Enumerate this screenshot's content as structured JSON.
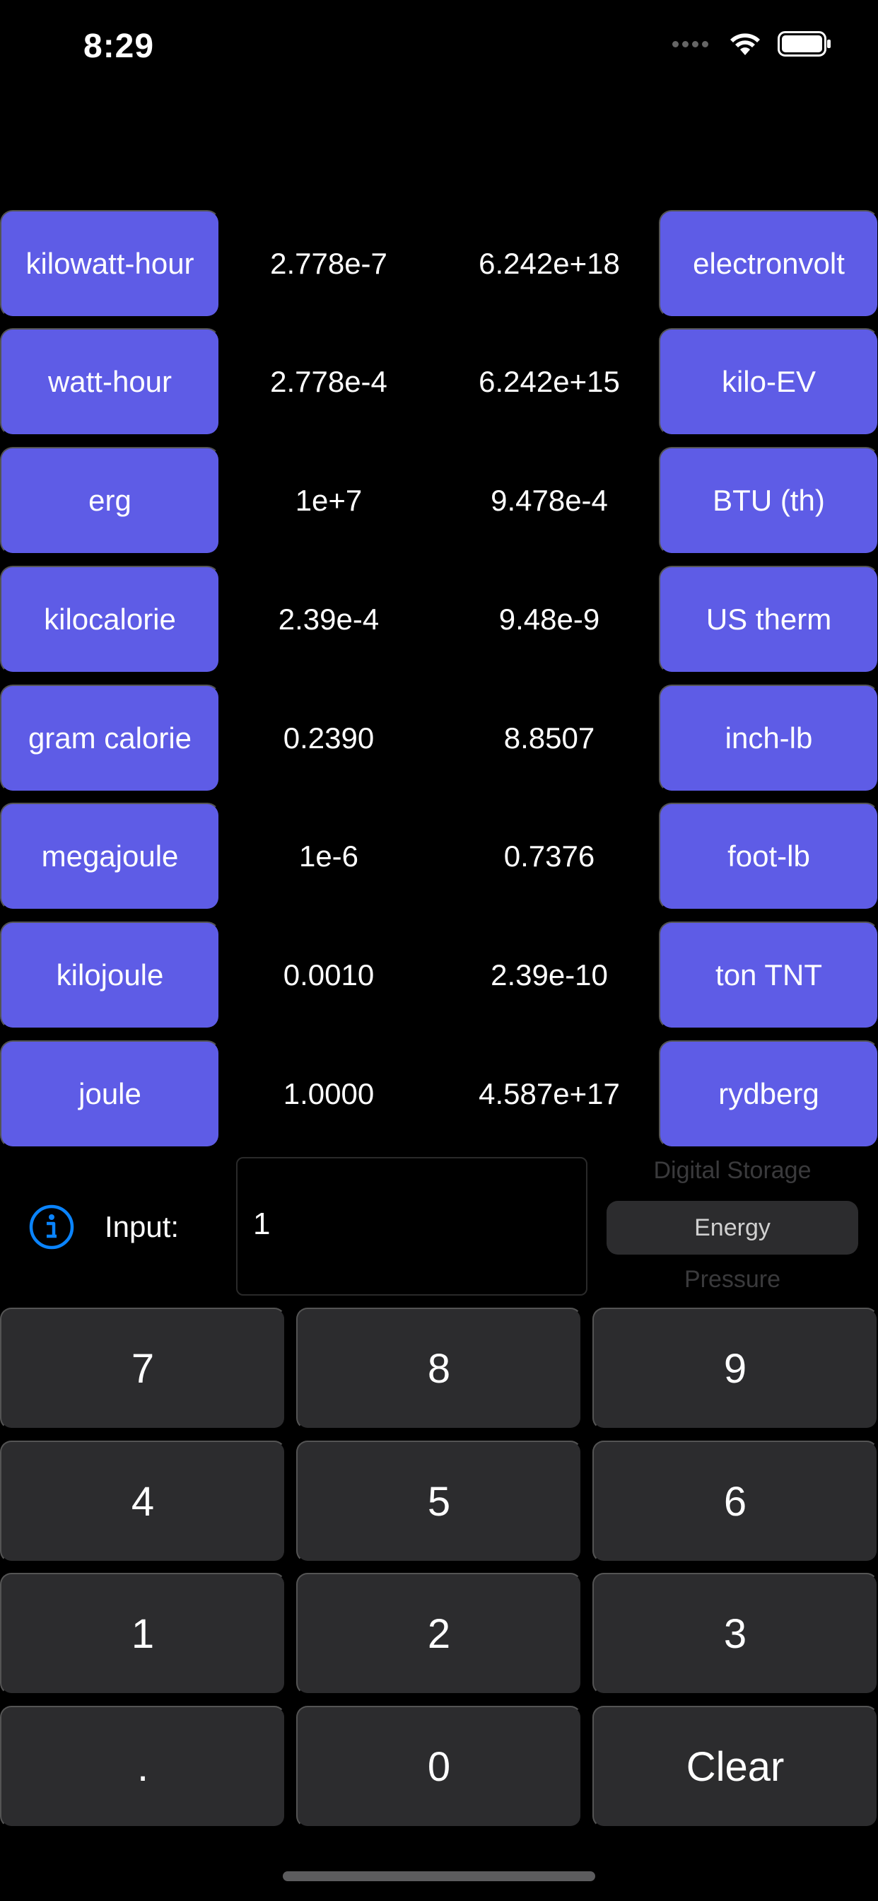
{
  "status_bar": {
    "time": "8:29"
  },
  "conversions": [
    {
      "left_unit": "kilowatt-hour",
      "left_value": "2.778e-7",
      "right_value": "6.242e+18",
      "right_unit": "electronvolt"
    },
    {
      "left_unit": "watt-hour",
      "left_value": "2.778e-4",
      "right_value": "6.242e+15",
      "right_unit": "kilo-EV"
    },
    {
      "left_unit": "erg",
      "left_value": "1e+7",
      "right_value": "9.478e-4",
      "right_unit": "BTU (th)"
    },
    {
      "left_unit": "kilocalorie",
      "left_value": "2.39e-4",
      "right_value": "9.48e-9",
      "right_unit": "US therm"
    },
    {
      "left_unit": "gram calorie",
      "left_value": "0.2390",
      "right_value": "8.8507",
      "right_unit": "inch-lb"
    },
    {
      "left_unit": "megajoule",
      "left_value": "1e-6",
      "right_value": "0.7376",
      "right_unit": "foot-lb"
    },
    {
      "left_unit": "kilojoule",
      "left_value": "0.0010",
      "right_value": "2.39e-10",
      "right_unit": "ton TNT"
    },
    {
      "left_unit": "joule",
      "left_value": "1.0000",
      "right_value": "4.587e+17",
      "right_unit": "rydberg"
    }
  ],
  "input": {
    "label": "Input:",
    "value": "1"
  },
  "category_picker": {
    "above": "Digital Storage",
    "selected": "Energy",
    "below": "Pressure"
  },
  "keypad": {
    "keys": [
      "7",
      "8",
      "9",
      "4",
      "5",
      "6",
      "1",
      "2",
      "3",
      ".",
      "0",
      "Clear"
    ]
  },
  "colors": {
    "unit_button": "#5e5ce6",
    "key_background": "#2c2c2e",
    "info_icon": "#0a84ff",
    "background": "#000000"
  },
  "icons": {
    "info": "info-circle-icon",
    "wifi": "wifi-icon",
    "battery": "battery-icon",
    "signal": "cellular-signal-icon"
  }
}
